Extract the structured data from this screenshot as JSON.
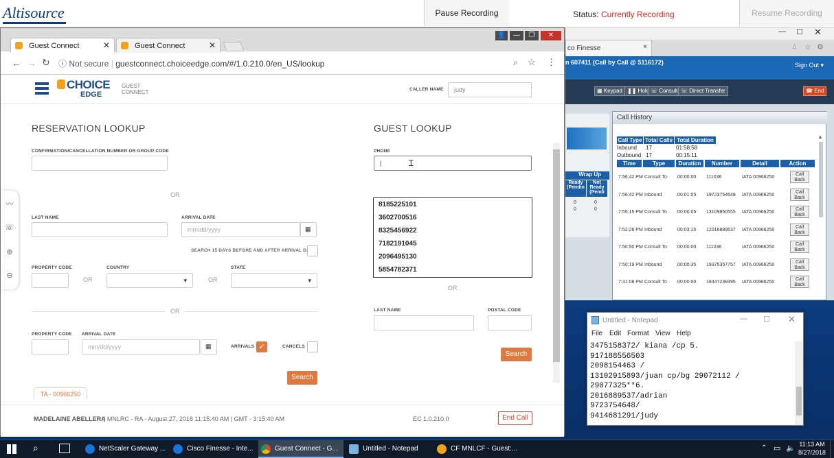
{
  "top_bar": {
    "logo": "Altisource",
    "pause_label": "Pause Recording",
    "status_label": "Status:",
    "status_value": "Currently Recording",
    "resume_label": "Resume Recording"
  },
  "browser": {
    "tabs": [
      {
        "label": "Guest Connect"
      },
      {
        "label": "Guest Connect"
      }
    ],
    "not_secure": "Not secure",
    "url": "guestconnect.choiceedge.com/#/1.0.210.0/en_US/lookup"
  },
  "page": {
    "logo_choice": "CHOICE",
    "logo_edge": "EDGE",
    "logo_guest": "GUEST",
    "logo_connect": "CONNECT",
    "caller_name_label": "CALLER NAME",
    "caller_name_value": "judy",
    "reservation_title": "RESERVATION LOOKUP",
    "confirmation_label": "CONFIRMATION/CANCELLATION NUMBER OR GROUP CODE",
    "or": "OR",
    "last_name_label": "LAST NAME",
    "arrival_date_label": "ARRIVAL DATE",
    "date_placeholder": "mm/dd/yyyy",
    "search_15_label": "SEARCH 15 DAYS BEFORE AND AFTER ARRIVAL DATE",
    "property_code_label": "PROPERTY CODE",
    "country_label": "COUNTRY",
    "state_label": "STATE",
    "arrivals_label": "ARRIVALS",
    "cancels_label": "CANCELS",
    "search_label": "Search",
    "ta_tag": "TA - 00966250",
    "guest_title": "GUEST LOOKUP",
    "phone_label": "PHONE",
    "phone_suggestions": [
      "8185225101",
      "3602700516",
      "8325456922",
      "7182191045",
      "2096495130",
      "5854782371"
    ],
    "postal_code_label": "POSTAL CODE",
    "footer_agent": "MADELAINE ABELLERA",
    "footer_info": "| MNLRC - RA - August 27, 2018 11:15:40 AM | GMT - 3:15:40 AM",
    "version": "EC 1.0.210.0",
    "end_call_label": "End Call"
  },
  "finesse": {
    "tab_label": "co Finesse",
    "header_text": "n 607411 (Call by Call @ 5116172)",
    "sign_out": "Sign Out ▾",
    "buttons": [
      "Keypad",
      "Hold",
      "Consult",
      "Direct Transfer",
      "End"
    ],
    "wrap_up": "Wrap Up",
    "ready_pending": "Ready (Pendin",
    "not_ready_pending": "Not Ready (Pendi",
    "zeros": [
      "0",
      "0",
      "0",
      "0"
    ],
    "call_history_title": "Call History",
    "summary_headers": [
      "Call Type",
      "Total Calls",
      "Total Duration"
    ],
    "summary_rows": [
      [
        "Inbound",
        "17",
        "01:58:58"
      ],
      [
        "Outbound",
        "17",
        "00:15:11"
      ]
    ],
    "table_headers": [
      "Time",
      "Type",
      "Duration",
      "Number",
      "Detail",
      "Action"
    ],
    "rows": [
      [
        "7:56:42 PM",
        "Consult To",
        "00:00:00",
        "111038",
        "IATA 00966250"
      ],
      [
        "7:56:42 PM",
        "Inbound",
        "00:01:05",
        "19723754648",
        "IATA 00966250"
      ],
      [
        "7:55:15 PM",
        "Consult To",
        "00:00:05",
        "13109850555",
        "IATA 00966250"
      ],
      [
        "7:52:26 PM",
        "Inbound",
        "00:03:15",
        "12016889537",
        "IATA 00966250"
      ],
      [
        "7:50:50 PM",
        "Consult To",
        "00:00:00",
        "111038",
        "IATA 00966250"
      ],
      [
        "7:50:19 PM",
        "Inbound",
        "00:00:35",
        "19375357757",
        "IATA 00966250"
      ],
      [
        "7:31:08 PM",
        "Consult To",
        "00:00:00",
        "18447239395",
        "IATA 00966250"
      ]
    ],
    "call_back": "Call Back"
  },
  "notepad": {
    "title": "Untitled - Notepad",
    "menu": [
      "File",
      "Edit",
      "Format",
      "View",
      "Help"
    ],
    "text": "3475158372/ kiana /cp 5.\n917188556503\n2098154463 /\n13102915893/juan cp/bg 29072112 /\n29077325**6.\n2016889537/adrian\n9723754648/\n9414681291/judy"
  },
  "taskbar": {
    "items": [
      "NetScaler Gateway ...",
      "Cisco Finesse - Inte...",
      "Guest Connect - G...",
      "Untitled - Notepad",
      "CF MNLCF - Guest:..."
    ],
    "time": "11:13 AM",
    "date": "8/27/2018"
  },
  "colors": {
    "accent_orange": "#e0793f",
    "status_red": "#e0241b",
    "finesse_blue": "#1b69b5"
  }
}
